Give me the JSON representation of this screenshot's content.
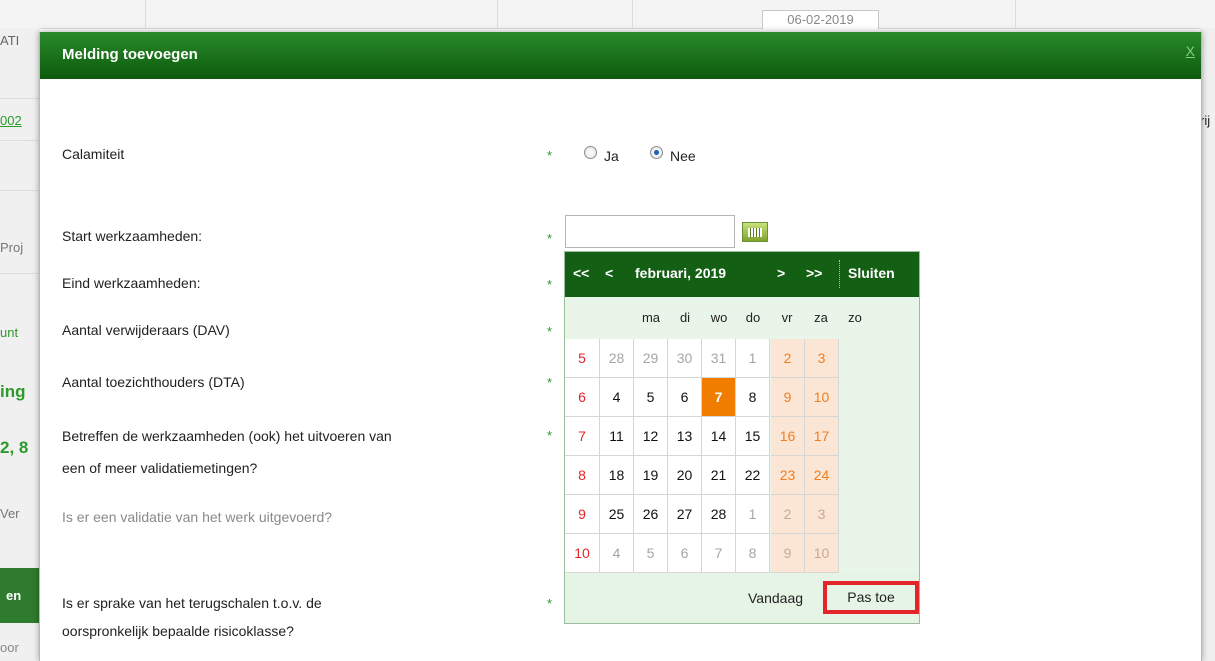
{
  "background": {
    "top_date": "06-02-2019",
    "left_fragments": [
      "ATI",
      "002",
      "Proj",
      "unt",
      "ing",
      "2, 8",
      "Ver",
      "en",
      "oor"
    ],
    "right_fragment": "rij"
  },
  "dialog": {
    "title": "Melding toevoegen",
    "close_label": "X",
    "required_mark": "*",
    "fields": {
      "calamiteit": "Calamiteit",
      "start": "Start werkzaamheden:",
      "eind": "Eind werkzaamheden:",
      "dav": "Aantal verwijderaars (DAV)",
      "dta": "Aantal toezichthouders (DTA)",
      "validatie_q1": "Betreffen de werkzaamheden (ook) het uitvoeren van",
      "validatie_q2": "een of meer validatiemetingen?",
      "validatie_uitgevoerd": "Is er een validatie van het werk uitgevoerd?",
      "terugschalen_1": "Is er sprake van het terugschalen t.o.v. de",
      "terugschalen_2": "oorspronkelijk bepaalde risicoklasse?"
    },
    "radio": {
      "ja": "Ja",
      "nee": "Nee",
      "selected": "Nee"
    },
    "start_value": ""
  },
  "calendar": {
    "prev_year": "<<",
    "prev_month": "<",
    "month_label": "februari, 2019",
    "next_month": ">",
    "next_year": ">>",
    "close": "Sluiten",
    "weekdays": [
      "ma",
      "di",
      "wo",
      "do",
      "vr",
      "za",
      "zo"
    ],
    "weeks": [
      {
        "wk": "5",
        "days": [
          "28",
          "29",
          "30",
          "31",
          "1",
          "2",
          "3"
        ],
        "other": [
          true,
          true,
          true,
          true,
          false,
          false,
          false
        ]
      },
      {
        "wk": "6",
        "days": [
          "4",
          "5",
          "6",
          "7",
          "8",
          "9",
          "10"
        ],
        "other": [
          false,
          false,
          false,
          false,
          false,
          false,
          false
        ]
      },
      {
        "wk": "7",
        "days": [
          "11",
          "12",
          "13",
          "14",
          "15",
          "16",
          "17"
        ],
        "other": [
          false,
          false,
          false,
          false,
          false,
          false,
          false
        ]
      },
      {
        "wk": "8",
        "days": [
          "18",
          "19",
          "20",
          "21",
          "22",
          "23",
          "24"
        ],
        "other": [
          false,
          false,
          false,
          false,
          false,
          false,
          false
        ]
      },
      {
        "wk": "9",
        "days": [
          "25",
          "26",
          "27",
          "28",
          "1",
          "2",
          "3"
        ],
        "other": [
          false,
          false,
          false,
          false,
          true,
          true,
          true
        ]
      },
      {
        "wk": "10",
        "days": [
          "4",
          "5",
          "6",
          "7",
          "8",
          "9",
          "10"
        ],
        "other": [
          true,
          true,
          true,
          true,
          true,
          true,
          true
        ]
      }
    ],
    "faded_first_week": [
      true,
      true,
      true,
      true,
      true,
      false,
      false
    ],
    "today": "7",
    "today_label": "Vandaag",
    "apply_label": "Pas toe"
  },
  "colors": {
    "header_green": "#135f13",
    "today_orange": "#f07d00",
    "weeknum_red": "#e3242b",
    "highlight_red": "#e3242b"
  }
}
